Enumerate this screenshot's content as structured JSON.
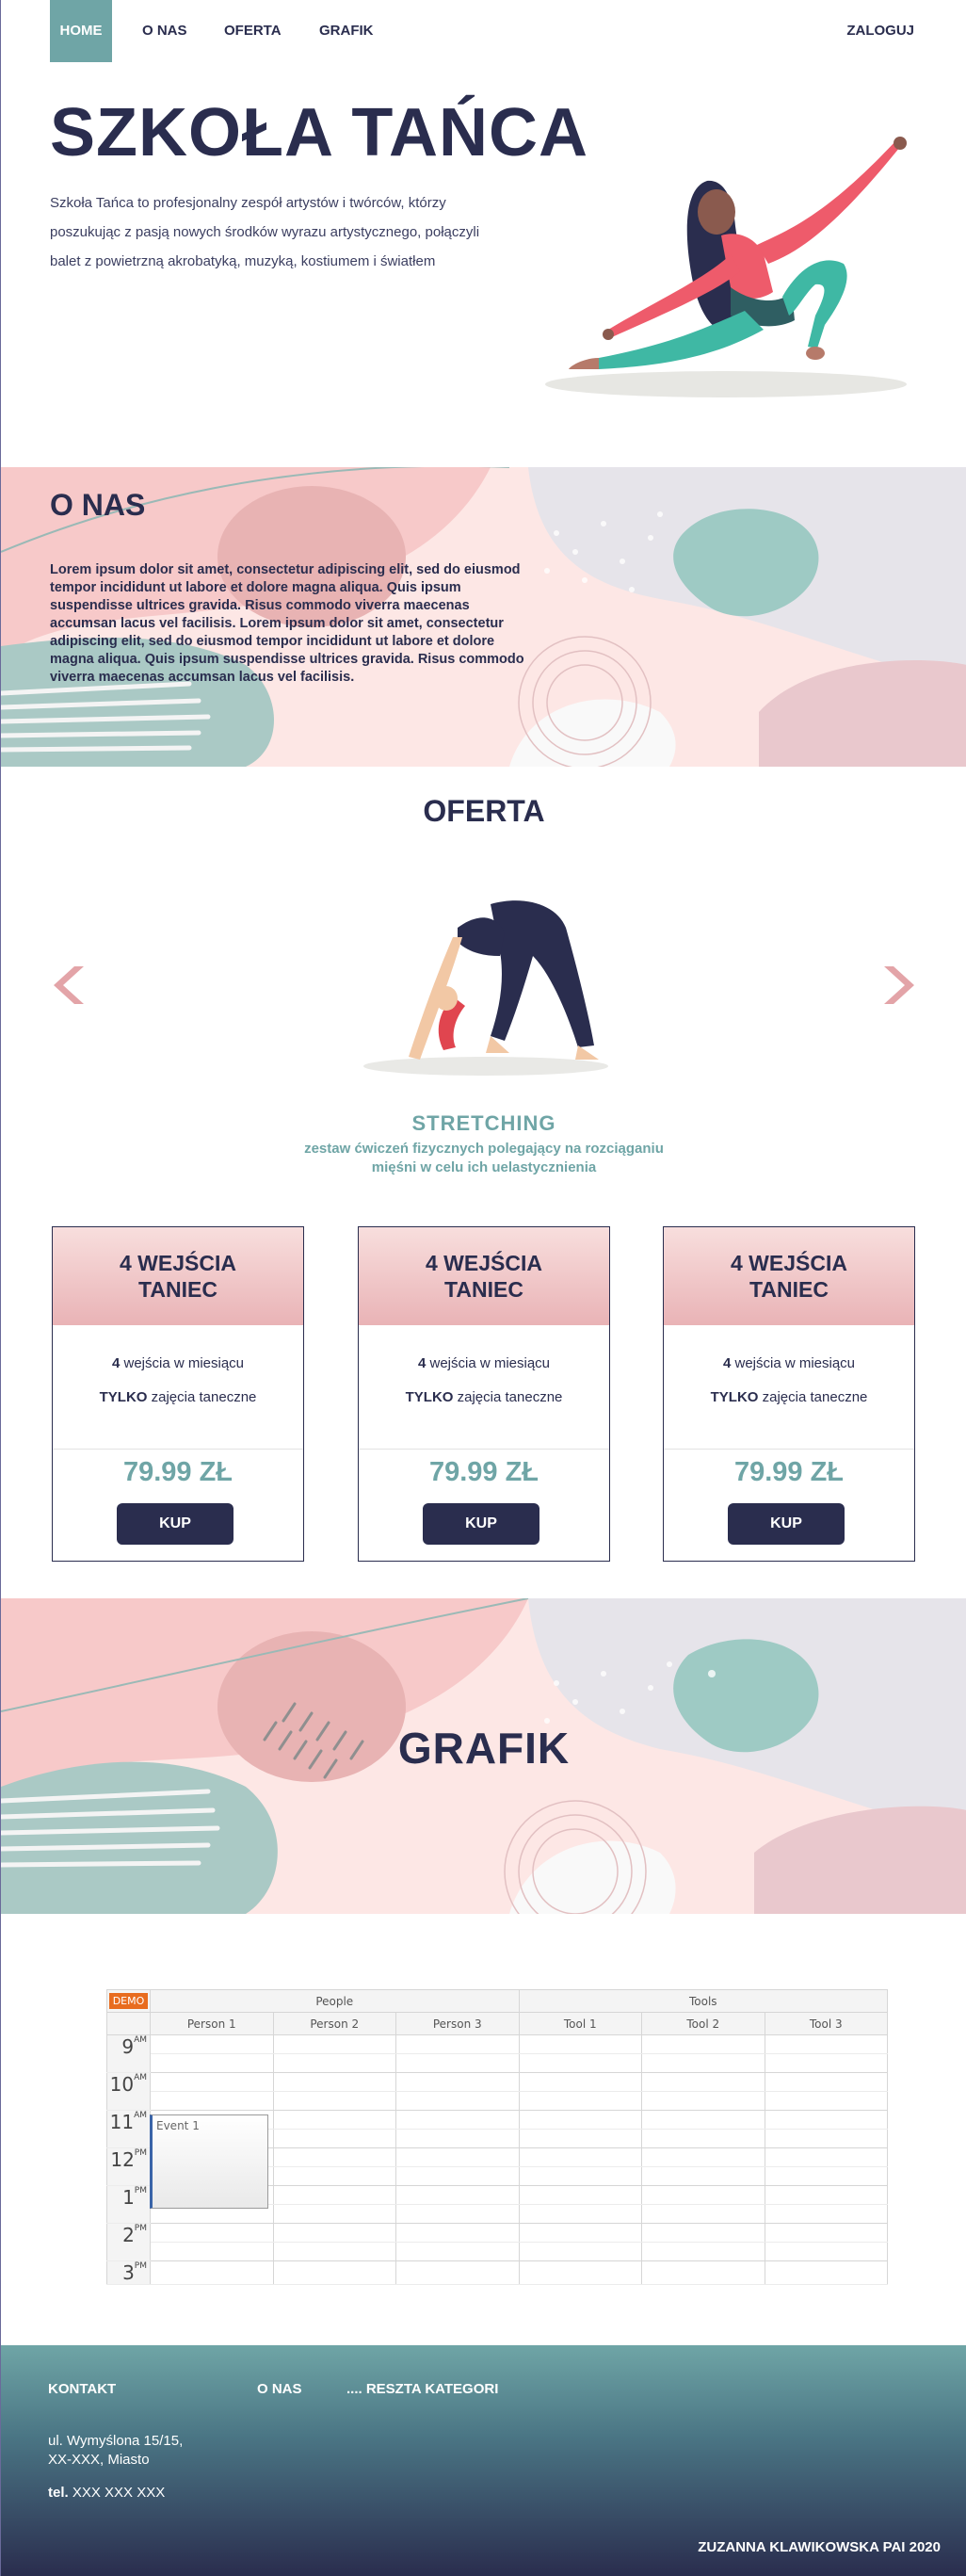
{
  "nav": {
    "home": "HOME",
    "about": "O NAS",
    "offer": "OFERTA",
    "schedule": "GRAFIK",
    "login": "ZALOGUJ"
  },
  "hero": {
    "title": "SZKOŁA TAŃCA",
    "text": "Szkoła Tańca to profesjonalny zespół artystów i twórców, którzy poszukując z pasją nowych środków wyrazu artystycznego, połączyli balet z powietrzną akrobatyką, muzyką, kostiumem i światłem"
  },
  "about": {
    "title": "O NAS",
    "text": "Lorem ipsum dolor sit amet, consectetur adipiscing elit, sed do eiusmod tempor incididunt ut labore et dolore magna aliqua. Quis ipsum suspendisse ultrices gravida. Risus commodo viverra maecenas accumsan lacus vel facilisis. Lorem ipsum dolor sit amet, consectetur adipiscing elit, sed do eiusmod tempor incididunt ut labore et dolore magna aliqua. Quis ipsum suspendisse ultrices gravida. Risus commodo viverra maecenas accumsan lacus vel facilisis."
  },
  "offer": {
    "title": "OFERTA",
    "slide": {
      "name": "STRETCHING",
      "description": "zestaw ćwiczeń fizycznych polegający na rozciąganiu mięśni w celu ich uelastycznienia"
    },
    "cards": [
      {
        "title_1": "4 WEJŚCIA",
        "title_2": "TANIEC",
        "count": "4",
        "line1_rest": " wejścia w miesiącu",
        "only": "TYLKO",
        "line2_rest": " zajęcia taneczne",
        "price": "79.99 ZŁ",
        "button": "KUP"
      },
      {
        "title_1": "4 WEJŚCIA",
        "title_2": "TANIEC",
        "count": "4",
        "line1_rest": " wejścia w miesiącu",
        "only": "TYLKO",
        "line2_rest": " zajęcia taneczne",
        "price": "79.99 ZŁ",
        "button": "KUP"
      },
      {
        "title_1": "4 WEJŚCIA",
        "title_2": "TANIEC",
        "count": "4",
        "line1_rest": " wejścia w miesiącu",
        "only": "TYLKO",
        "line2_rest": " zajęcia taneczne",
        "price": "79.99 ZŁ",
        "button": "KUP"
      }
    ]
  },
  "schedule": {
    "title": "GRAFIK",
    "demo": "DEMO",
    "groups": [
      "People",
      "Tools"
    ],
    "columns": [
      "Person 1",
      "Person 2",
      "Person 3",
      "Tool 1",
      "Tool 2",
      "Tool 3"
    ],
    "hours": [
      {
        "h": "9",
        "ampm": "AM"
      },
      {
        "h": "10",
        "ampm": "AM"
      },
      {
        "h": "11",
        "ampm": "AM"
      },
      {
        "h": "12",
        "ampm": "PM"
      },
      {
        "h": "1",
        "ampm": "PM"
      },
      {
        "h": "2",
        "ampm": "PM"
      },
      {
        "h": "3",
        "ampm": "PM"
      }
    ],
    "event": "Event 1"
  },
  "footer": {
    "contact": "KONTAKT",
    "about": "O NAS",
    "rest": ".... RESZTA KATEGORI",
    "address_1": "ul. Wymyślona 15/15,",
    "address_2": "XX-XXX, Miasto",
    "tel_label": "tel.",
    "tel_value": " XXX XXX XXX",
    "author": "ZUZANNA KLAWIKOWSKA PAI 2020"
  },
  "colors": {
    "navy": "#2a2d4e",
    "teal": "#6fa5a6",
    "pink": "#f4c5c6"
  }
}
